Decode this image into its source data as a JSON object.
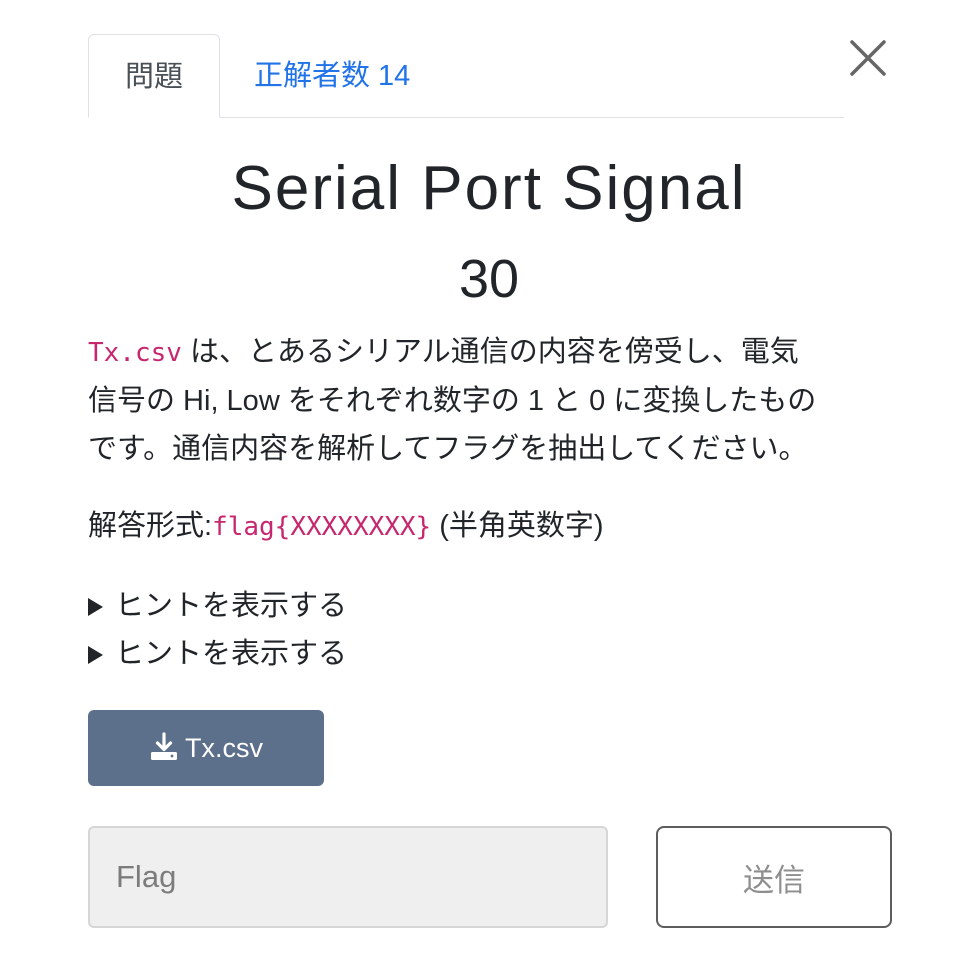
{
  "tabs": {
    "problem_label": "問題",
    "solvers_label": "正解者数 14"
  },
  "close_icon": "close-icon",
  "challenge": {
    "title": "Serial Port Signal",
    "points": "30",
    "file_code": "Tx.csv",
    "description_line1": "は、とあるシリアル通信の内容を傍受し、電気",
    "description_line2": "信号の Hi, Low をそれぞれ数字の 1 と 0 に変換したもの",
    "description_line3": "です。通信内容を解析してフラグを抽出してください。",
    "format_label": "解答形式:",
    "format_code": "flag{XXXXXXXX}",
    "format_suffix": " (半角英数字)"
  },
  "hints": [
    {
      "label": "ヒントを表示する"
    },
    {
      "label": "ヒントを表示する"
    }
  ],
  "download": {
    "label": "Tx.csv",
    "icon": "download-icon"
  },
  "flag_input": {
    "placeholder": "Flag",
    "value": ""
  },
  "submit": {
    "label": "送信"
  },
  "colors": {
    "link": "#2173e8",
    "code": "#c7276e",
    "download_button": "#5d708b",
    "input_background": "#efefef"
  }
}
